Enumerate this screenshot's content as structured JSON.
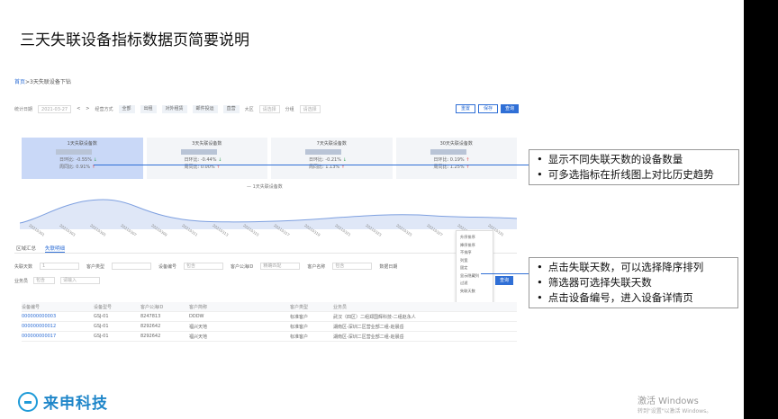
{
  "title": "三天失联设备指标数据页简要说明",
  "screenshot": {
    "breadcrumb": {
      "home": "首页",
      "sep": ">",
      "current": "3天失联设备下钻"
    },
    "filter": {
      "date_label": "统计日期",
      "date_value": "2021-03-27",
      "prev": "<",
      "next": ">",
      "range_label": "经营方式",
      "pills": [
        "全部",
        "出租",
        "对外租赁",
        "邮件投运",
        "直营"
      ],
      "city_label": "大区",
      "city_placeholder": "请选择",
      "region_label": "分组",
      "region_placeholder": "请选择",
      "buttons": [
        "重置",
        "保存",
        "查询"
      ]
    },
    "cards": [
      {
        "title": "1天失联设备数",
        "dod_label": "日环比:",
        "dod": "-0.55%",
        "dod_dir": "↓",
        "wow_label": "周同比:",
        "wow": "0.91%",
        "wow_dir": "↑"
      },
      {
        "title": "3天失联设备数",
        "dod_label": "日环比:",
        "dod": "-0.44%",
        "dod_dir": "↓",
        "wow_label": "周同比:",
        "wow": "0.00%",
        "wow_dir": "↑"
      },
      {
        "title": "7天失联设备数",
        "dod_label": "日环比:",
        "dod": "-0.21%",
        "dod_dir": "↓",
        "wow_label": "周同比:",
        "wow": "1.13%",
        "wow_dir": "↑"
      },
      {
        "title": "30天失联设备数",
        "dod_label": "日环比:",
        "dod": "0.19%",
        "dod_dir": "↑",
        "wow_label": "周同比:",
        "wow": "1.25%",
        "wow_dir": "↑"
      }
    ],
    "legend": "— 1天失联设备数",
    "x_labels": [
      "20210301",
      "20210303",
      "20210305",
      "20210307",
      "20210309",
      "20210311",
      "20210313",
      "20210315",
      "20210317",
      "20210319",
      "20210321",
      "20210323",
      "20210325",
      "20210327",
      "20210329",
      "20210331"
    ],
    "tabs": [
      "区域汇总",
      "失联明细"
    ],
    "filter2": {
      "label1": "失联天数",
      "value1": "1",
      "label2": "客户类型",
      "label3": "设备编号",
      "value3": "包含",
      "label4": "客户公海ID",
      "value4": "精确匹配",
      "label5": "客户名称",
      "value5": "包含",
      "label6": "数据日期"
    },
    "filter3": {
      "label1": "业务员",
      "value1": "包含",
      "placeholder": "请输入",
      "query": "查询"
    },
    "menu": [
      "升序排序",
      "降序排序",
      "不排序",
      "列宽",
      "固定",
      "显示隐藏列",
      "过滤",
      "失联天数"
    ],
    "table": {
      "headers": [
        "设备编号",
        "设备型号",
        "客户公海ID",
        "客户简称",
        "客户类型",
        "业务员"
      ],
      "rows": [
        [
          "000000000003",
          "GSJ-01",
          "8247813",
          "DDDW",
          "标准客户",
          "武汉（四区）二组郑国辉科技-二组赵永人"
        ],
        [
          "000000000012",
          "GSJ-01",
          "8292642",
          "福兴天地",
          "标准客户",
          "湖南区-深圳二区营业部二组-赵晨岳"
        ],
        [
          "000000000017",
          "GSJ-01",
          "8292642",
          "福兴天地",
          "标准客户",
          "湖南区-深圳二区营业部二组-赵晨岳"
        ]
      ]
    }
  },
  "annotations": {
    "box1": [
      "显示不同失联天数的设备数量",
      "可多选指标在折线图上对比历史趋势"
    ],
    "box2": [
      "点击失联天数，可以选择降序排列",
      "筛选器可选择失联天数",
      "点击设备编号，进入设备详情页"
    ]
  },
  "logo": {
    "text": "来申科技"
  },
  "watermark": {
    "line1": "激活 Windows",
    "line2": "转到\"设置\"以激活 Windows。"
  },
  "colors": {
    "accent": "#2f6fd6",
    "logo": "#1f86c9",
    "up": "#e04848",
    "down": "#3aa55a"
  }
}
